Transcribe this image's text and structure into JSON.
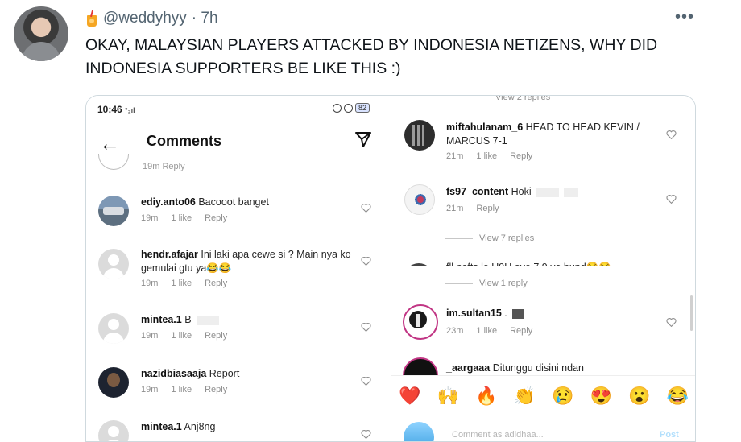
{
  "tweet": {
    "handle": "@weddyhyy",
    "time": "· 7h",
    "more": "•••",
    "text": "OKAY, MALAYSIAN PLAYERS ATTACKED BY INDONESIA NETIZENS, WHY DID INDONESIA SUPPORTERS BE LIKE THIS :)"
  },
  "left_screenshot": {
    "status_time": "10:46",
    "status_signal": "°₂ıl",
    "battery": "82",
    "title": "Comments",
    "cut_top_text": "19m    Reply",
    "comments": [
      {
        "user": "ediy.anto06",
        "text": "Bacooot banget",
        "time": "19m",
        "likes": "1 like",
        "reply": "Reply"
      },
      {
        "user": "hendr.afajar",
        "text": "Ini laki apa cewe si ? Main nya ko gemulai gtu ya😂😂",
        "time": "19m",
        "likes": "1 like",
        "reply": "Reply"
      },
      {
        "user": "mintea.1",
        "text": "B",
        "time": "19m",
        "likes": "1 like",
        "reply": "Reply"
      },
      {
        "user": "nazidbiasaaja",
        "text": "Report",
        "time": "19m",
        "likes": "1 like",
        "reply": "Reply"
      },
      {
        "user": "mintea.1",
        "text": "Anj8ng"
      }
    ]
  },
  "right_screenshot": {
    "cut_top_text": "View 2 replies",
    "comments": [
      {
        "user": "miftahulanam_6",
        "text": "HEAD TO HEAD KEVIN / MARCUS 7-1",
        "time": "21m",
        "likes": "1 like",
        "reply": "Reply"
      },
      {
        "user": "fs97_content",
        "text": "Hoki",
        "time": "21m",
        "reply": "Reply"
      },
      {
        "user": "im.sultan15",
        "text": ".",
        "time": "23m",
        "likes": "1 like",
        "reply": "Reply"
      },
      {
        "user": "_aargaaa",
        "text": "Ditunggu disini ndan"
      }
    ],
    "view_replies_1": "View 7 replies",
    "partial_comment": "fll.nofts.le U9U ove 7 9 ve bund😂😂",
    "view_replies_2": "View 1 reply",
    "emojis": [
      "❤️",
      "🙌",
      "🔥",
      "👏",
      "😢",
      "😍",
      "😮",
      "😂"
    ],
    "comment_placeholder": "Comment as adldhaa...",
    "post_label": "Post"
  }
}
